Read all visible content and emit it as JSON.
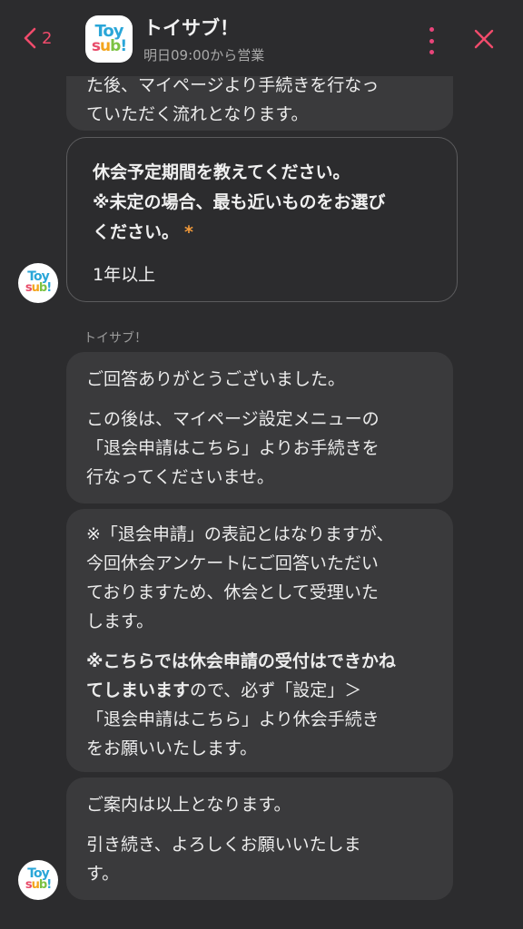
{
  "header": {
    "back_count": "2",
    "title": "トイサブ！",
    "subtitle": "明日09:00から営業"
  },
  "logo": {
    "line1": "Toy",
    "line2": "sub!"
  },
  "messages": {
    "m0": [
      "た後、マイページより手続きを行なっ",
      "ていただく流れとなります。"
    ],
    "form": {
      "question_lines": [
        "休会予定期間を教えてください。",
        "※未定の場合、最も近いものをお選び",
        "ください。"
      ],
      "required_mark": "*",
      "answer": "1年以上"
    },
    "sender_name": "トイサブ！",
    "m1": {
      "p1": "ご回答ありがとうございました。",
      "p2": [
        "この後は、マイページ設定メニューの",
        "「退会申請はこちら」よりお手続きを",
        "行なってくださいませ。"
      ]
    },
    "m2": {
      "p1": [
        "※「退会申請」の表記とはなりますが、",
        "今回休会アンケートにご回答いただい",
        "ておりますため、休会として受理いた",
        "します。"
      ],
      "p2_bold_1": "※こちらでは休会申請の受付はできかね",
      "p2_bold_2": "てしまいます",
      "p2_rest_2": "ので、必ず「設定」＞",
      "p2_lines": [
        "「退会申請はこちら」より休会手続き",
        "をお願いいたします。"
      ]
    },
    "m3": {
      "p1": "ご案内は以上となります。",
      "p2": [
        "引き続き、よろしくお願いいたしま",
        "す。"
      ]
    }
  },
  "colors": {
    "accent": "#f04b6b",
    "background": "#2c2c2e",
    "bubble": "#3a3a3c",
    "required": "#f29a3a"
  }
}
